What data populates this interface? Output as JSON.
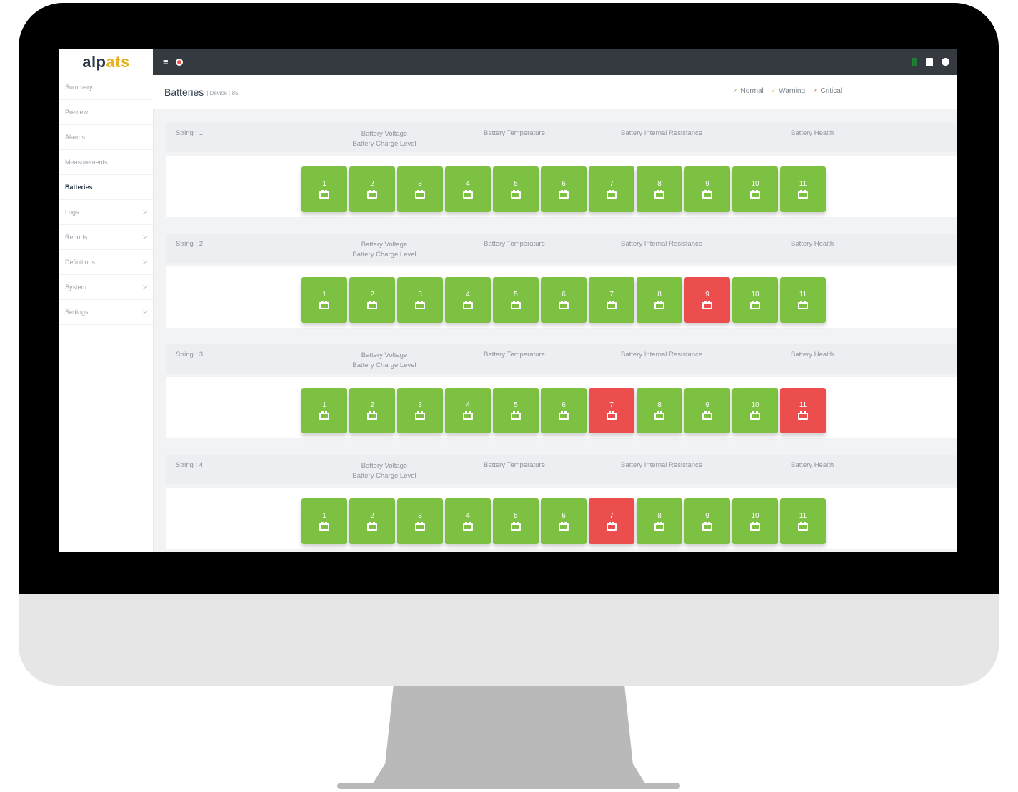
{
  "brand": {
    "logo_text": "alp",
    "logo_accent": "ats"
  },
  "sidebar": {
    "items": [
      {
        "label": "Summary",
        "chevron": ""
      },
      {
        "label": "Preview",
        "chevron": ""
      },
      {
        "label": "Alarms",
        "chevron": ""
      },
      {
        "label": "Measurements",
        "chevron": ""
      },
      {
        "label": "Batteries",
        "chevron": "",
        "active": true
      },
      {
        "label": "Logs",
        "chevron": ">"
      },
      {
        "label": "Reports",
        "chevron": ">"
      },
      {
        "label": "Definitions",
        "chevron": ">"
      },
      {
        "label": "System",
        "chevron": ">"
      },
      {
        "label": "Settings",
        "chevron": ">"
      }
    ]
  },
  "topbar": {
    "menu_icon": "≡"
  },
  "header": {
    "title": "Batteries",
    "subtitle": "| Device : 85"
  },
  "legend": {
    "normal": "Normal",
    "warning": "Warning",
    "critical": "Critical",
    "normal_color": "#7cc142",
    "warning_color": "#f0a93b",
    "critical_color": "#e85a4f"
  },
  "columns": {
    "voltage": "Battery Voltage",
    "charge": "Battery Charge Level",
    "temperature": "Battery Temperature",
    "resistance": "Battery Internal Resistance",
    "health": "Battery Health"
  },
  "colors": {
    "normal": "#7cc142",
    "critical": "#ec4d4d"
  },
  "strings": [
    {
      "label": "String : 1",
      "batteries": [
        {
          "n": "1",
          "s": "normal"
        },
        {
          "n": "2",
          "s": "normal"
        },
        {
          "n": "3",
          "s": "normal"
        },
        {
          "n": "4",
          "s": "normal"
        },
        {
          "n": "5",
          "s": "normal"
        },
        {
          "n": "6",
          "s": "normal"
        },
        {
          "n": "7",
          "s": "normal"
        },
        {
          "n": "8",
          "s": "normal"
        },
        {
          "n": "9",
          "s": "normal"
        },
        {
          "n": "10",
          "s": "normal"
        },
        {
          "n": "11",
          "s": "normal"
        }
      ]
    },
    {
      "label": "String : 2",
      "batteries": [
        {
          "n": "1",
          "s": "normal"
        },
        {
          "n": "2",
          "s": "normal"
        },
        {
          "n": "3",
          "s": "normal"
        },
        {
          "n": "4",
          "s": "normal"
        },
        {
          "n": "5",
          "s": "normal"
        },
        {
          "n": "6",
          "s": "normal"
        },
        {
          "n": "7",
          "s": "normal"
        },
        {
          "n": "8",
          "s": "normal"
        },
        {
          "n": "9",
          "s": "critical"
        },
        {
          "n": "10",
          "s": "normal"
        },
        {
          "n": "11",
          "s": "normal"
        }
      ]
    },
    {
      "label": "String : 3",
      "batteries": [
        {
          "n": "1",
          "s": "normal"
        },
        {
          "n": "2",
          "s": "normal"
        },
        {
          "n": "3",
          "s": "normal"
        },
        {
          "n": "4",
          "s": "normal"
        },
        {
          "n": "5",
          "s": "normal"
        },
        {
          "n": "6",
          "s": "normal"
        },
        {
          "n": "7",
          "s": "critical"
        },
        {
          "n": "8",
          "s": "normal"
        },
        {
          "n": "9",
          "s": "normal"
        },
        {
          "n": "10",
          "s": "normal"
        },
        {
          "n": "11",
          "s": "critical"
        }
      ]
    },
    {
      "label": "String : 4",
      "batteries": [
        {
          "n": "1",
          "s": "normal"
        },
        {
          "n": "2",
          "s": "normal"
        },
        {
          "n": "3",
          "s": "normal"
        },
        {
          "n": "4",
          "s": "normal"
        },
        {
          "n": "5",
          "s": "normal"
        },
        {
          "n": "6",
          "s": "normal"
        },
        {
          "n": "7",
          "s": "critical"
        },
        {
          "n": "8",
          "s": "normal"
        },
        {
          "n": "9",
          "s": "normal"
        },
        {
          "n": "10",
          "s": "normal"
        },
        {
          "n": "11",
          "s": "normal"
        }
      ]
    }
  ]
}
